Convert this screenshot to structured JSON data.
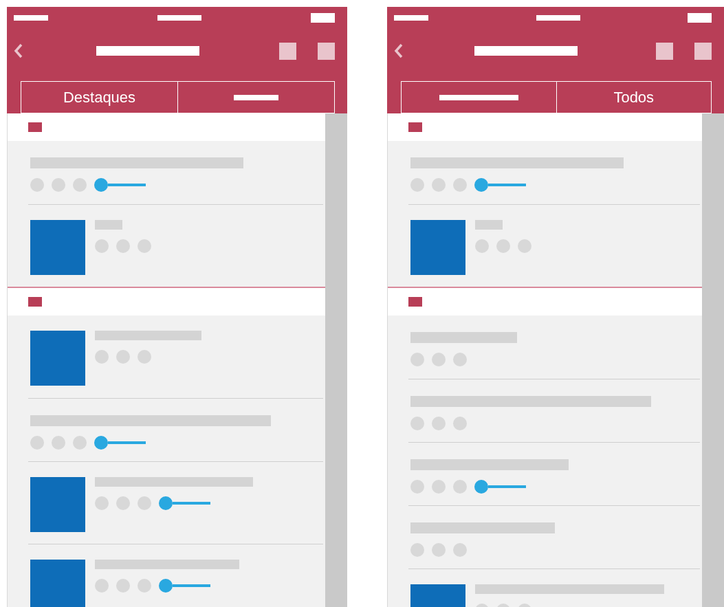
{
  "screens": [
    {
      "tabs": [
        {
          "kind": "text",
          "label": "Destaques"
        },
        {
          "kind": "placeholder"
        }
      ],
      "sections": [
        {
          "items": [
            {
              "kind": "text",
              "highlighted": true
            },
            {
              "kind": "thumbnail",
              "highlighted": false
            }
          ]
        },
        {
          "items": [
            {
              "kind": "thumbnail",
              "highlighted": false
            },
            {
              "kind": "text",
              "highlighted": true
            },
            {
              "kind": "thumbnail",
              "highlighted": true
            },
            {
              "kind": "thumbnail",
              "highlighted": true
            }
          ]
        }
      ]
    },
    {
      "tabs": [
        {
          "kind": "placeholder"
        },
        {
          "kind": "text",
          "label": "Todos"
        }
      ],
      "sections": [
        {
          "items": [
            {
              "kind": "text",
              "highlighted": true
            },
            {
              "kind": "thumbnail",
              "highlighted": false
            }
          ]
        },
        {
          "items": [
            {
              "kind": "text",
              "highlighted": false
            },
            {
              "kind": "text",
              "highlighted": false
            },
            {
              "kind": "text",
              "highlighted": true
            },
            {
              "kind": "text",
              "highlighted": false
            },
            {
              "kind": "thumbnail",
              "highlighted": false
            }
          ]
        }
      ]
    }
  ]
}
